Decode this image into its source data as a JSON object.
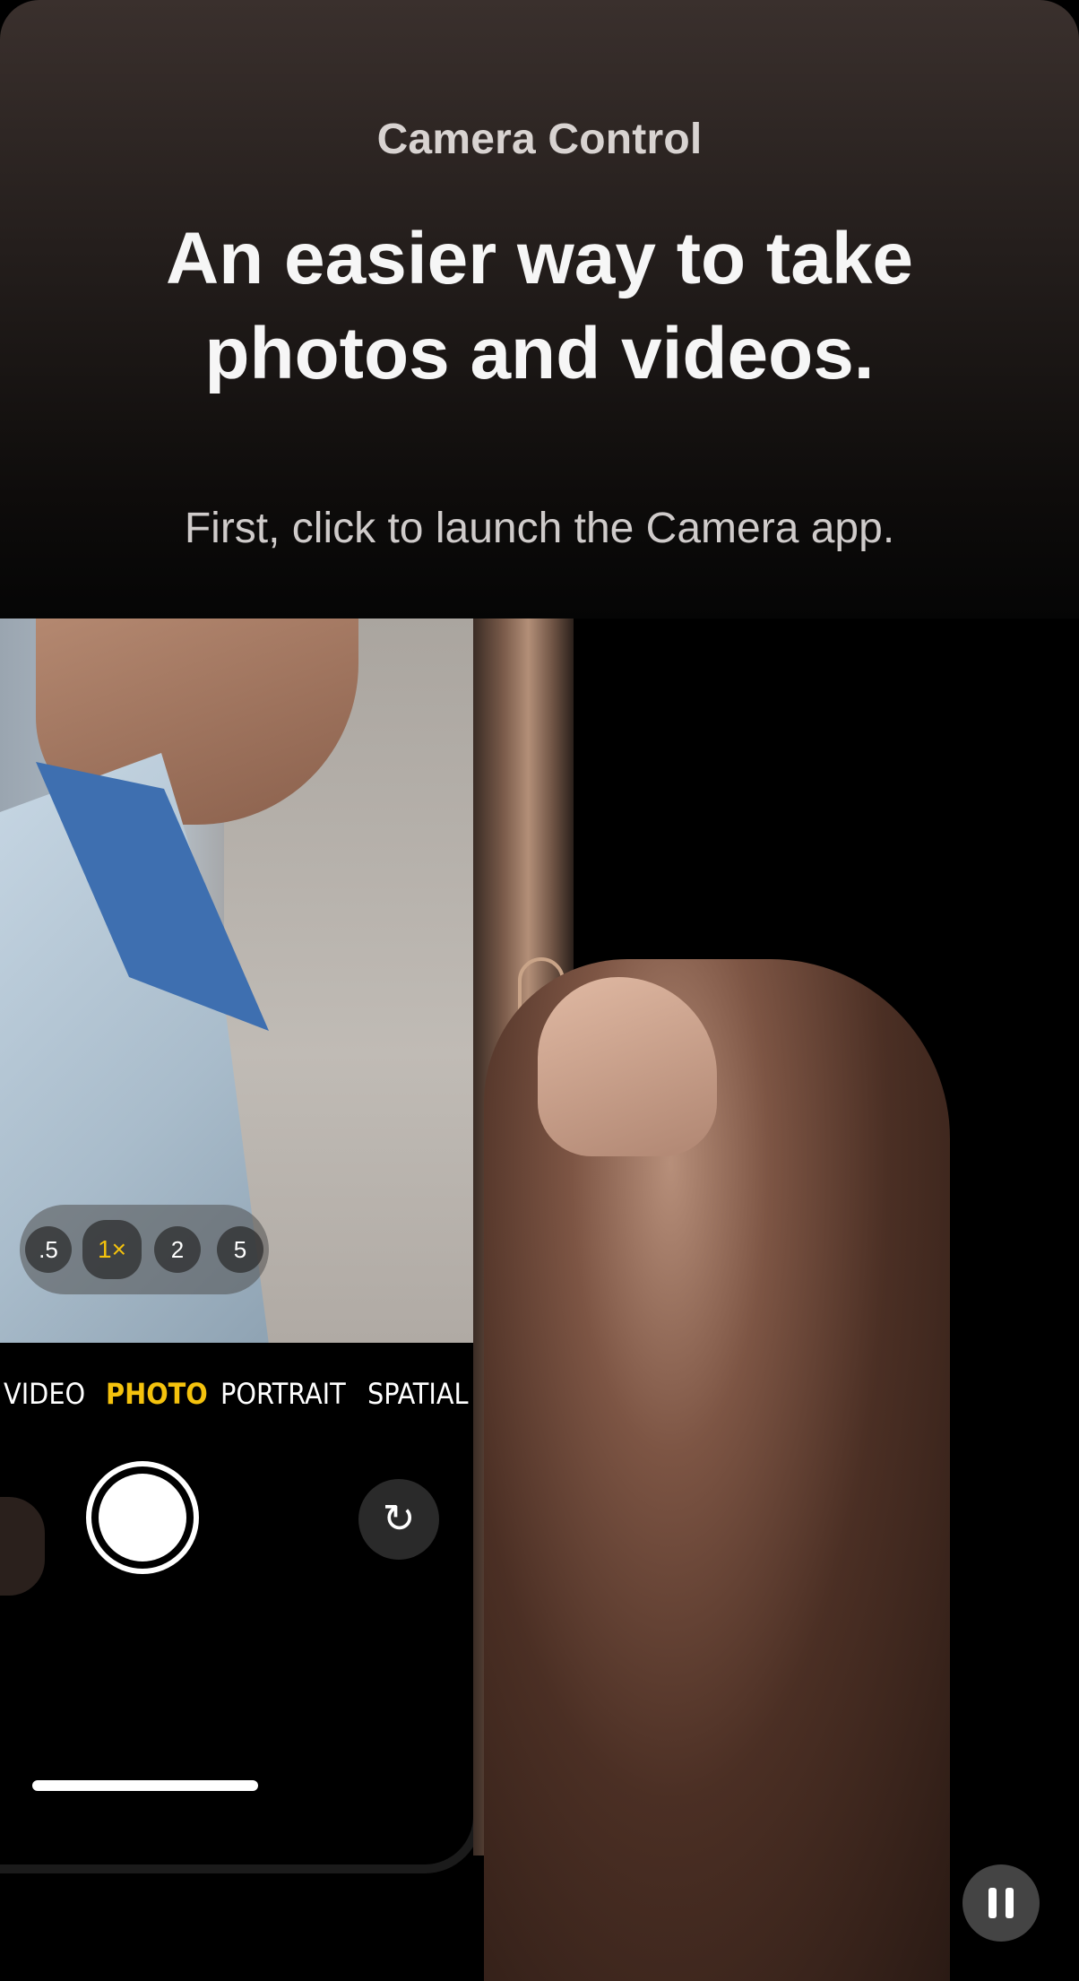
{
  "header": {
    "eyebrow": "Camera Control",
    "headline_line1": "An easier way to take",
    "headline_line2": "photos and videos.",
    "subline": "First, click to launch the Camera app."
  },
  "camera_ui": {
    "zoom_options": [
      ".5",
      "1×",
      "2",
      "5"
    ],
    "active_zoom": "1×",
    "modes": [
      "VIDEO",
      "PHOTO",
      "PORTRAIT",
      "SPATIAL"
    ],
    "active_mode": "PHOTO"
  },
  "controls": {
    "pause_icon": "pause-icon"
  },
  "colors": {
    "accent": "#f4c20d",
    "header_top": "#3a302d",
    "background": "#000000"
  }
}
